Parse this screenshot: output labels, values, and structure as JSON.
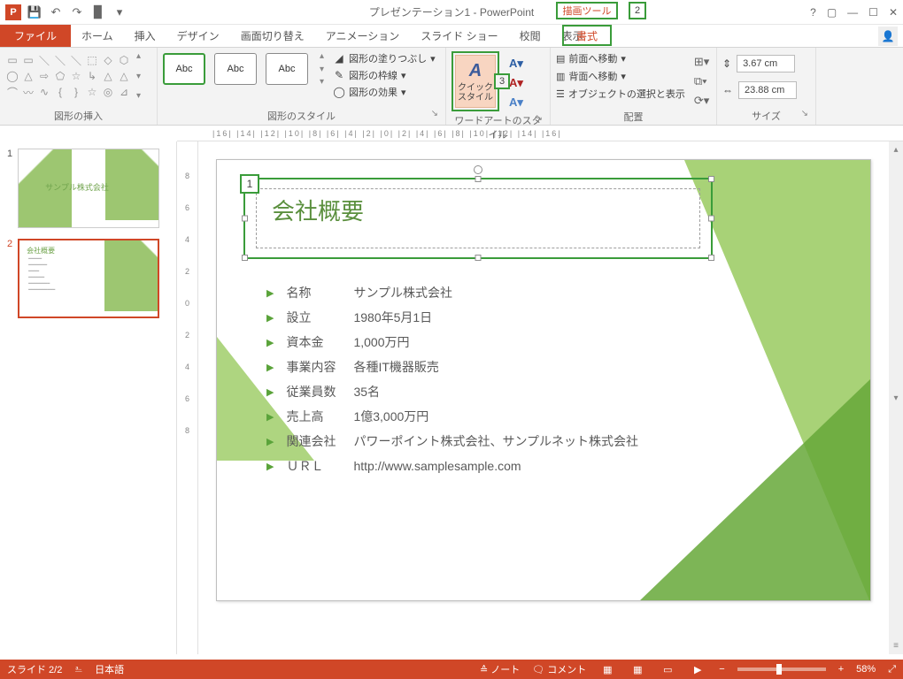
{
  "titlebar": {
    "title": "プレゼンテーション1 - PowerPoint",
    "drawing_tools": "描画ツール",
    "callout_drawing": "2"
  },
  "tabs": {
    "file": "ファイル",
    "items": [
      "ホーム",
      "挿入",
      "デザイン",
      "画面切り替え",
      "アニメーション",
      "スライド ショー",
      "校閲",
      "表示"
    ],
    "format": "書式"
  },
  "ribbon": {
    "shapes_group": "図形の挿入",
    "styles_group": "図形のスタイル",
    "wordart_group": "ワードアートのスタイル",
    "arrange_group": "配置",
    "size_group": "サイズ",
    "style_chip": "Abc",
    "fill": "図形の塗りつぶし",
    "outline": "図形の枠線",
    "effects": "図形の効果",
    "quickstyle": "クイック\nスタイル",
    "callout_quick": "3",
    "bring_forward": "前面へ移動",
    "send_backward": "背面へ移動",
    "selection_pane": "オブジェクトの選択と表示",
    "height": "3.67 cm",
    "width": "23.88 cm"
  },
  "ruler_h": "|16|  |14|  |12|  |10|  |8|  |6|  |4|  |2|  |0|  |2|  |4|  |6|  |8|  |10|  |12|  |14|  |16|",
  "ruler_v": [
    "8",
    "6",
    "4",
    "2",
    "0",
    "2",
    "4",
    "6",
    "8"
  ],
  "thumbs": {
    "n1": "1",
    "n2": "2",
    "t1_title": "サンプル株式会社",
    "t2_title": "会社概要"
  },
  "slide": {
    "callout": "1",
    "title": "会社概要",
    "rows": [
      {
        "label": "名称",
        "value": "サンプル株式会社"
      },
      {
        "label": "設立",
        "value": "1980年5月1日"
      },
      {
        "label": "資本金",
        "value": "1,000万円"
      },
      {
        "label": "事業内容",
        "value": "各種IT機器販売"
      },
      {
        "label": "従業員数",
        "value": "35名"
      },
      {
        "label": "売上高",
        "value": "1億3,000万円"
      },
      {
        "label": "関連会社",
        "value": "パワーポイント株式会社、サンプルネット株式会社"
      },
      {
        "label": "ＵＲＬ",
        "value": "http://www.samplesample.com"
      }
    ]
  },
  "status": {
    "slide": "スライド 2/2",
    "lang": "日本語",
    "notes": "ノート",
    "comments": "コメント",
    "zoom": "58%"
  }
}
